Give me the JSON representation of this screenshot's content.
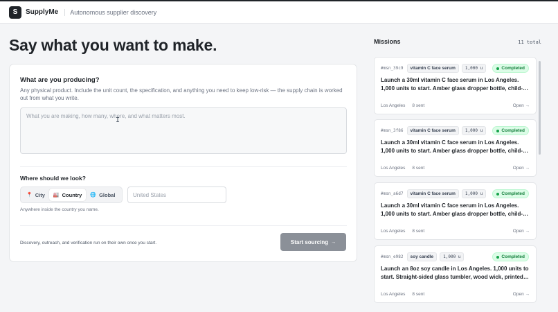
{
  "app": {
    "logo_letter": "S",
    "name": "SupplyMe",
    "tagline": "Autonomous supplier discovery"
  },
  "page_title": "Say what you want to make.",
  "form": {
    "question": "What are you producing?",
    "help": "Any physical product. Include the unit count, the specification, and anything you need to keep low-risk — the supply chain is worked out from what you write.",
    "textarea_placeholder": "What you are making, how many, where, and what matters most.",
    "textarea_value": "",
    "where_label": "Where should we look?",
    "scope_options": [
      {
        "label": "City",
        "icon": "pin-icon"
      },
      {
        "label": "Country",
        "icon": "factory-icon"
      },
      {
        "label": "Global",
        "icon": "globe-icon"
      }
    ],
    "scope_selected": "Country",
    "country_placeholder": "United States",
    "country_value": "",
    "where_help": "Anywhere inside the country you name.",
    "footer_note": "Discovery, outreach, and verification run on their own once you start.",
    "start_label": "Start sourcing",
    "start_arrow": "→"
  },
  "missions": {
    "title": "Missions",
    "count": "11 total",
    "items": [
      {
        "id": "#msn_39c9",
        "tag": "vitamin C face serum",
        "qty": "1,000 u",
        "status": "Completed",
        "text": "Launch a 30ml vitamin C face serum in Los Angeles. 1,000 units to start. Amber glass dropper bottle, child-…",
        "location": "Los Angeles",
        "sent": "8 sent",
        "open": "Open →"
      },
      {
        "id": "#msn_3f86",
        "tag": "vitamin C face serum",
        "qty": "1,000 u",
        "status": "Completed",
        "text": "Launch a 30ml vitamin C face serum in Los Angeles. 1,000 units to start. Amber glass dropper bottle, child-…",
        "location": "Los Angeles",
        "sent": "8 sent",
        "open": "Open →"
      },
      {
        "id": "#msn_a6d7",
        "tag": "vitamin C face serum",
        "qty": "1,000 u",
        "status": "Completed",
        "text": "Launch a 30ml vitamin C face serum in Los Angeles. 1,000 units to start. Amber glass dropper bottle, child-…",
        "location": "Los Angeles",
        "sent": "8 sent",
        "open": "Open →"
      },
      {
        "id": "#msn_e982",
        "tag": "soy candle",
        "qty": "1,000 u",
        "status": "Completed",
        "text": "Launch an 8oz soy candle in Los Angeles. 1,000 units to start. Straight-sided glass tumbler, wood wick, printed…",
        "location": "Los Angeles",
        "sent": "8 sent",
        "open": "Open →"
      }
    ]
  },
  "colors": {
    "accent": "#1f2328",
    "success": "#15803d",
    "button_disabled": "#8b9098"
  }
}
